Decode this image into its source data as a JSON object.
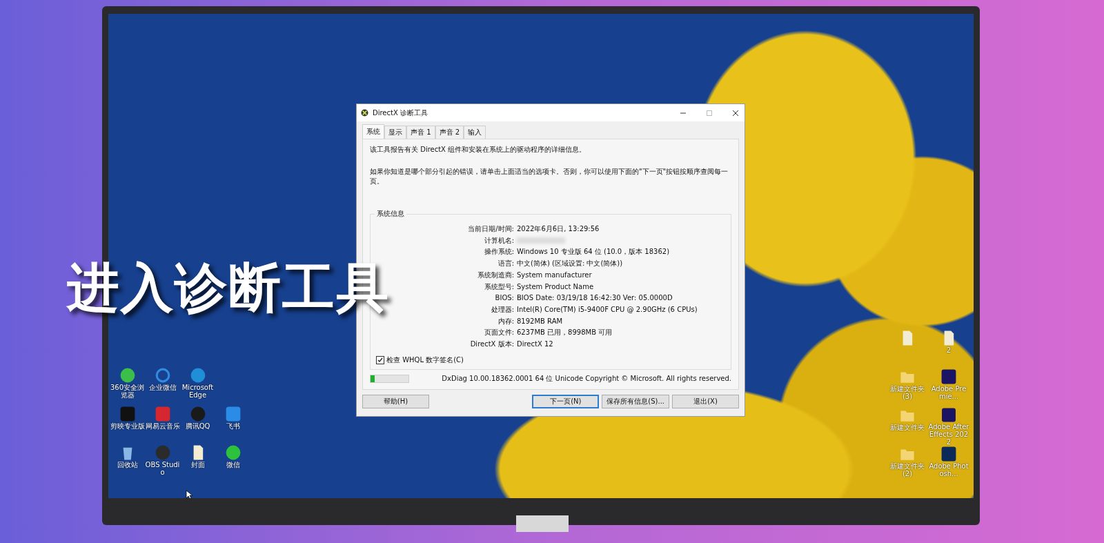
{
  "caption": "进入诊断工具",
  "dialog": {
    "title": "DirectX 诊断工具",
    "tabs": [
      {
        "label": "系统",
        "selected": true
      },
      {
        "label": "显示",
        "selected": false
      },
      {
        "label": "声音 1",
        "selected": false
      },
      {
        "label": "声音 2",
        "selected": false
      },
      {
        "label": "输入",
        "selected": false
      }
    ],
    "intro": "该工具报告有关 DirectX 组件和安装在系统上的驱动程序的详细信息。",
    "hint": "如果你知道是哪个部分引起的错误，请单击上面适当的选项卡。否则，你可以使用下面的\"下一页\"按钮按顺序查阅每一页。",
    "group_title": "系统信息",
    "info": [
      {
        "label": "当前日期/时间:",
        "value": "2022年6月6日, 13:29:56",
        "blurred": false
      },
      {
        "label": "计算机名:",
        "blurred": true
      },
      {
        "label": "操作系统:",
        "value": "Windows 10 专业版 64 位 (10.0，版本 18362)",
        "blurred": false
      },
      {
        "label": "语言:",
        "value": "中文(简体) (区域设置: 中文(简体))",
        "blurred": false
      },
      {
        "label": "系统制造商:",
        "value": "System manufacturer",
        "blurred": false
      },
      {
        "label": "系统型号:",
        "value": "System Product Name",
        "blurred": false
      },
      {
        "label": "BIOS:",
        "value": "BIOS Date: 03/19/18 16:42:30 Ver: 05.0000D",
        "blurred": false
      },
      {
        "label": "处理器:",
        "value": "Intel(R) Core(TM) i5-9400F CPU @ 2.90GHz (6 CPUs)",
        "blurred": false
      },
      {
        "label": "内存:",
        "value": "8192MB RAM",
        "blurred": false
      },
      {
        "label": "页面文件:",
        "value": "6237MB 已用，8998MB 可用",
        "blurred": false
      },
      {
        "label": "DirectX 版本:",
        "value": "DirectX 12",
        "blurred": false
      }
    ],
    "whql": {
      "label": "检查 WHQL 数字签名(C)",
      "checked": true
    },
    "progress": {
      "level": 0.1
    },
    "version": "DxDiag 10.00.18362.0001 64 位 Unicode  Copyright © Microsoft. All rights reserved.",
    "buttons": [
      {
        "label": "帮助(H)",
        "focused": false
      },
      {
        "label": "下一页(N)",
        "focused": true
      },
      {
        "label": "保存所有信息(S)...",
        "focused": false
      },
      {
        "label": "退出(X)",
        "focused": false
      }
    ]
  },
  "desktop_left": [
    {
      "label": "360安全浏览器",
      "kind": "browser"
    },
    {
      "label": "企业微信",
      "kind": "wecom"
    },
    {
      "label": "Microsoft Edge",
      "kind": "edge"
    },
    {
      "kind": "none"
    },
    {
      "label": "剪映专业版",
      "kind": "capcut"
    },
    {
      "label": "网易云音乐",
      "kind": "music"
    },
    {
      "label": "腾讯QQ",
      "kind": "qq"
    },
    {
      "label": "飞书",
      "kind": "feishu"
    },
    {
      "label": "回收站",
      "kind": "bin"
    },
    {
      "label": "OBS Studio",
      "kind": "obs"
    },
    {
      "label": "封面",
      "kind": "file"
    },
    {
      "label": "微信",
      "kind": "wechat"
    }
  ],
  "desktop_right": [
    {
      "kind": "file"
    },
    {
      "label": "2",
      "kind": "file"
    },
    {
      "label": "新建文件夹 (3)",
      "kind": "folder"
    },
    {
      "label": "Adobe Premie...",
      "kind": "pr"
    },
    {
      "label": "新建文件夹",
      "kind": "folder"
    },
    {
      "label": "Adobe After Effects 2022",
      "kind": "ae"
    },
    {
      "label": "新建文件夹 (2)",
      "kind": "folder"
    },
    {
      "label": "Adobe Photosh...",
      "kind": "ps"
    }
  ]
}
